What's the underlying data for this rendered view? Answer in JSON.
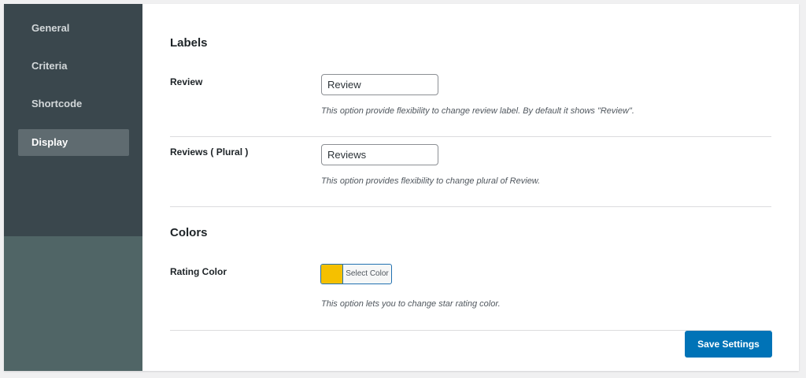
{
  "sidebar": {
    "items": [
      {
        "label": "General",
        "active": false
      },
      {
        "label": "Criteria",
        "active": false
      },
      {
        "label": "Shortcode",
        "active": false
      },
      {
        "label": "Display",
        "active": true
      }
    ]
  },
  "labels_section": {
    "title": "Labels",
    "review": {
      "label": "Review",
      "value": "Review",
      "description": "This option provide flexibility to change review label. By default it shows \"Review\"."
    },
    "reviews_plural": {
      "label": "Reviews ( Plural )",
      "value": "Reviews",
      "description": "This option provides flexibility to change plural of Review."
    }
  },
  "colors_section": {
    "title": "Colors",
    "rating_color": {
      "label": "Rating Color",
      "button_label": "Select Color",
      "color": "#f5c000",
      "description": "This option lets you to change star rating color."
    }
  },
  "actions": {
    "save_label": "Save Settings"
  },
  "theme": {
    "sidebar_dark": "#3a474d",
    "sidebar_light": "#506566",
    "accent": "#0073b7"
  }
}
